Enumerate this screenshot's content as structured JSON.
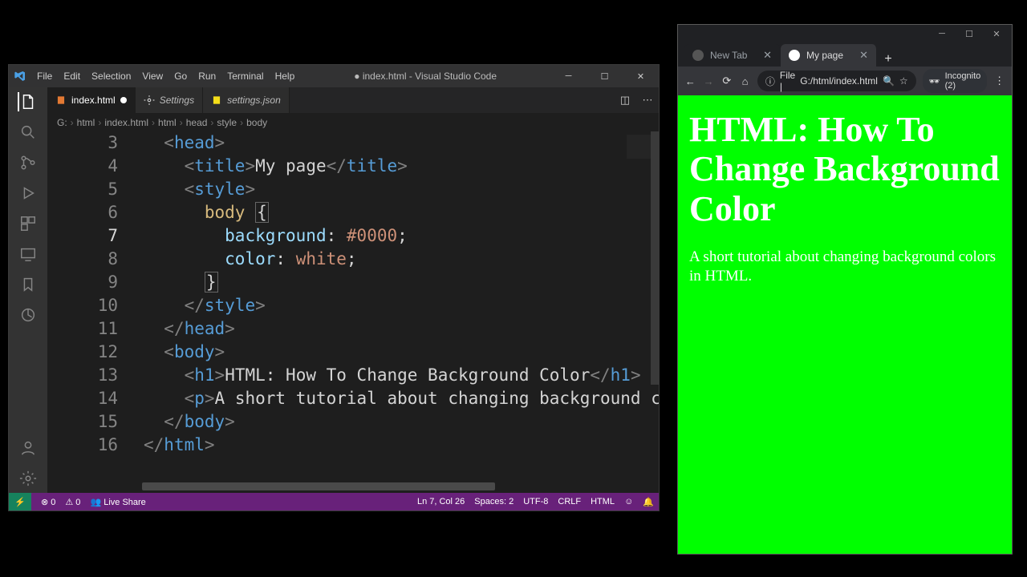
{
  "vscode": {
    "title": "● index.html - Visual Studio Code",
    "menus": [
      "File",
      "Edit",
      "Selection",
      "View",
      "Go",
      "Run",
      "Terminal",
      "Help"
    ],
    "tabs": [
      {
        "label": "index.html",
        "active": true,
        "dirty": true
      },
      {
        "label": "Settings",
        "active": false,
        "dirty": false
      },
      {
        "label": "settings.json",
        "active": false,
        "dirty": false
      }
    ],
    "breadcrumbs": [
      "G:",
      "html",
      "index.html",
      "html",
      "head",
      "style",
      "body"
    ],
    "lines": [
      {
        "n": 3,
        "indent": 1,
        "html": "<span class='tag'>&lt;</span><span class='name'>head</span><span class='tag'>&gt;</span>"
      },
      {
        "n": 4,
        "indent": 2,
        "html": "<span class='tag'>&lt;</span><span class='name'>title</span><span class='tag'>&gt;</span>My page<span class='tag'>&lt;/</span><span class='name'>title</span><span class='tag'>&gt;</span>"
      },
      {
        "n": 5,
        "indent": 2,
        "html": "<span class='tag'>&lt;</span><span class='name'>style</span><span class='tag'>&gt;</span>"
      },
      {
        "n": 6,
        "indent": 3,
        "html": "<span class='sel'>body</span> <span class='brace box'>{</span>"
      },
      {
        "n": 7,
        "indent": 4,
        "cur": true,
        "html": "<span class='prop'>background</span><span class='punc'>:</span> <span class='num'>#0000</span><span class='punc'>;</span>"
      },
      {
        "n": 8,
        "indent": 4,
        "html": "<span class='prop'>color</span><span class='punc'>:</span> <span class='val'>white</span><span class='punc'>;</span>"
      },
      {
        "n": 9,
        "indent": 3,
        "html": "<span class='brace box'>}</span>"
      },
      {
        "n": 10,
        "indent": 2,
        "html": "<span class='tag'>&lt;/</span><span class='name'>style</span><span class='tag'>&gt;</span>"
      },
      {
        "n": 11,
        "indent": 1,
        "html": "<span class='tag'>&lt;/</span><span class='name'>head</span><span class='tag'>&gt;</span>"
      },
      {
        "n": 12,
        "indent": 1,
        "html": "<span class='tag'>&lt;</span><span class='name'>body</span><span class='tag'>&gt;</span>"
      },
      {
        "n": 13,
        "indent": 2,
        "html": "<span class='tag'>&lt;</span><span class='name'>h1</span><span class='tag'>&gt;</span>HTML: How To Change Background Color<span class='tag'>&lt;/</span><span class='name'>h1</span><span class='tag'>&gt;</span>"
      },
      {
        "n": 14,
        "indent": 2,
        "html": "<span class='tag'>&lt;</span><span class='name'>p</span><span class='tag'>&gt;</span>A short tutorial about changing background colors"
      },
      {
        "n": 15,
        "indent": 1,
        "html": "<span class='tag'>&lt;/</span><span class='name'>body</span><span class='tag'>&gt;</span>"
      },
      {
        "n": 16,
        "indent": 0,
        "html": "<span class='tag'>&lt;/</span><span class='name'>html</span><span class='tag'>&gt;</span>"
      }
    ],
    "status": {
      "errors": "⊗ 0",
      "warnings": "⚠ 0",
      "liveshare": "Live Share",
      "lncol": "Ln 7, Col 26",
      "spaces": "Spaces: 2",
      "encoding": "UTF-8",
      "eol": "CRLF",
      "lang": "HTML"
    }
  },
  "browser": {
    "tabs": [
      {
        "label": "New Tab",
        "active": false
      },
      {
        "label": "My page",
        "active": true
      }
    ],
    "address_prefix": "File  |",
    "address": "G:/html/index.html",
    "incognito": "Incognito (2)",
    "page": {
      "h1": "HTML: How To Change Background Color",
      "p": "A short tutorial about changing background colors in HTML."
    }
  }
}
